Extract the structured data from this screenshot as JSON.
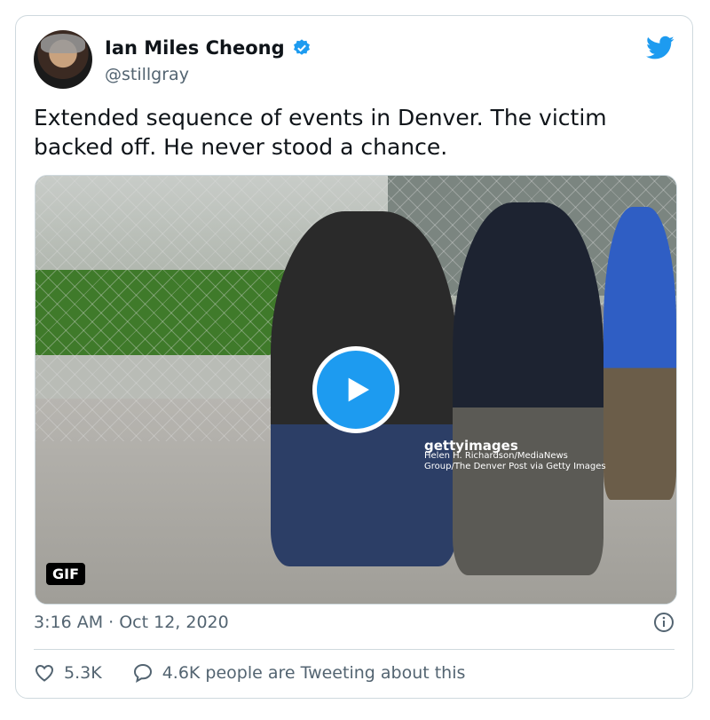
{
  "tweet": {
    "author": {
      "name": "Ian Miles Cheong",
      "handle": "@stillgray",
      "verified": true
    },
    "text": "Extended sequence of events in Denver. The victim backed off. He never stood a chance.",
    "media": {
      "badge": "GIF",
      "watermark_logo": "gettyimages",
      "watermark_credit_line1": "Helen H. Richardson/MediaNews",
      "watermark_credit_line2": "Group/The Denver Post via Getty Images"
    },
    "timestamp": "3:16 AM · Oct 12, 2020",
    "likes": "5.3K",
    "tweeting_text": "4.6K people are Tweeting about this"
  },
  "colors": {
    "accent": "#1d9bf0",
    "secondary_text": "#536471",
    "border": "#cfd9de"
  },
  "icons": [
    "verified-badge-icon",
    "twitter-bird-icon",
    "play-icon",
    "info-icon",
    "heart-icon",
    "speech-bubble-icon"
  ]
}
